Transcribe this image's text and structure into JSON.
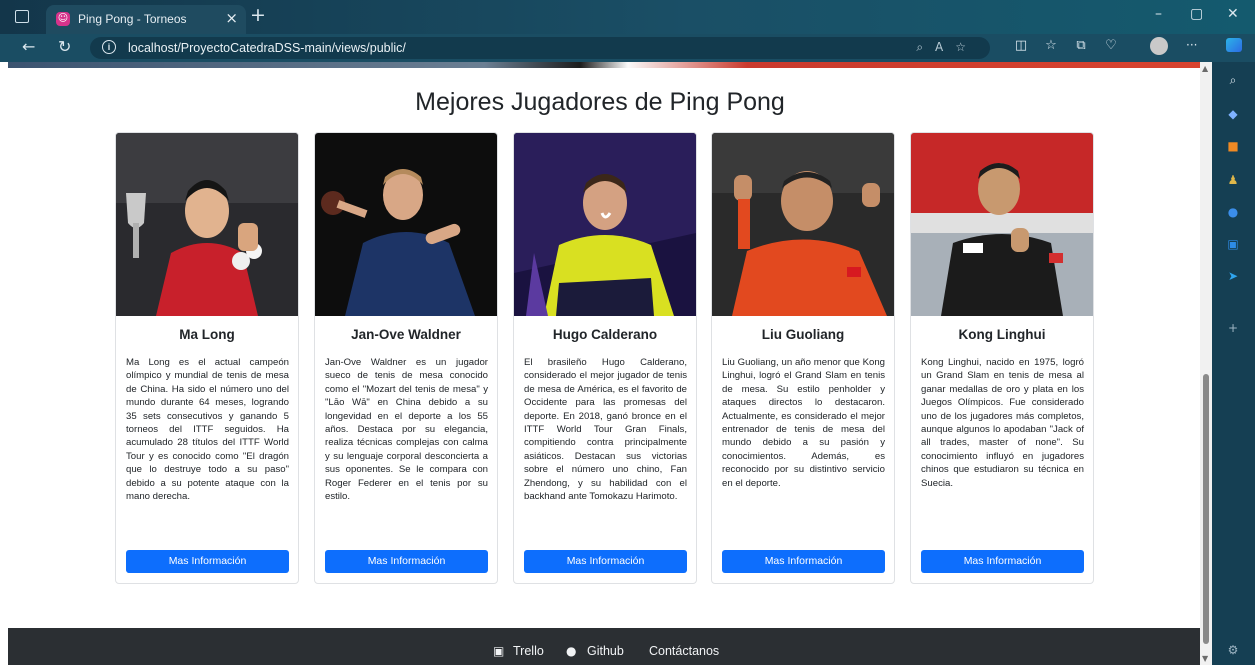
{
  "browser": {
    "tab_title": "Ping Pong - Torneos",
    "tab_close": "×",
    "new_tab": "+",
    "url": "localhost/ProyectoCatedraDSS-main/views/public/",
    "window_controls": {
      "minimize": "–",
      "restore": "▢",
      "close": "✕"
    }
  },
  "page": {
    "section_title": "Mejores Jugadores de Ping Pong",
    "players": [
      {
        "name": "Ma Long",
        "description": "Ma Long es el actual campeón olímpico y mundial de tenis de mesa de China. Ha sido el número uno del mundo durante 64 meses, logrando 35 sets consecutivos y ganando 5 torneos del ITTF seguidos. Ha acumulado 28 títulos del ITTF World Tour y es conocido como \"El dragón que lo destruye todo a su paso\" debido a su potente ataque con la mano derecha.",
        "button": "Mas Información"
      },
      {
        "name": "Jan-Ove Waldner",
        "description": "Jan-Ove Waldner es un jugador sueco de tenis de mesa conocido como el \"Mozart del tenis de mesa\" y \"Lāo Wā\" en China debido a su longevidad en el deporte a los 55 años. Destaca por su elegancia, realiza técnicas complejas con calma y su lenguaje corporal desconcierta a sus oponentes. Se le compara con Roger Federer en el tenis por su estilo.",
        "button": "Mas Información"
      },
      {
        "name": "Hugo Calderano",
        "description": "El brasileño Hugo Calderano, considerado el mejor jugador de tenis de mesa de América, es el favorito de Occidente para las promesas del deporte. En 2018, ganó bronce en el ITTF World Tour Gran Finals, compitiendo contra principalmente asiáticos. Destacan sus victorias sobre el número uno chino, Fan Zhendong, y su habilidad con el backhand ante Tomokazu Harimoto.",
        "button": "Mas Información"
      },
      {
        "name": "Liu Guoliang",
        "description": "Liu Guoliang, un año menor que Kong Linghui, logró el Grand Slam en tenis de mesa. Su estilo penholder y ataques directos lo destacaron. Actualmente, es considerado el mejor entrenador de tenis de mesa del mundo debido a su pasión y conocimientos. Además, es reconocido por su distintivo servicio en el deporte.",
        "button": "Mas Información"
      },
      {
        "name": "Kong Linghui",
        "description": "Kong Linghui, nacido en 1975, logró un Grand Slam en tenis de mesa al ganar medallas de oro y plata en los Juegos Olímpicos. Fue considerado uno de los jugadores más completos, aunque algunos lo apodaban \"Jack of all trades, master of none\". Su conocimiento influyó en jugadores chinos que estudiaron su técnica en Suecia.",
        "button": "Mas Información"
      }
    ]
  },
  "footer": {
    "trello": "Trello",
    "github": "Github",
    "contact": "Contáctanos"
  }
}
